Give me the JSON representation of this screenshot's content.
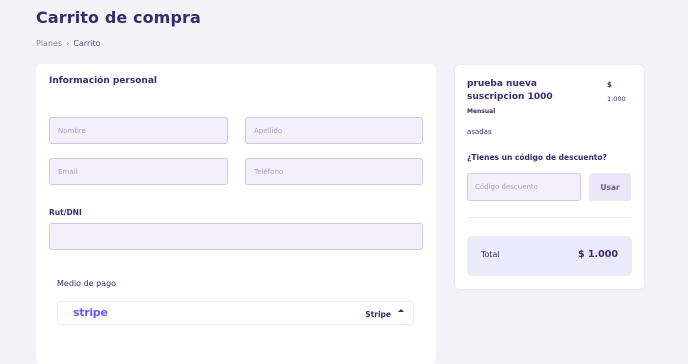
{
  "page": {
    "title": "Carrito de compra"
  },
  "breadcrumb": {
    "items": [
      "Planes",
      "Carrito"
    ],
    "separator": "›"
  },
  "personal_info": {
    "title": "Información personal",
    "fields": {
      "nombre": {
        "placeholder": "Nombre",
        "value": ""
      },
      "apellido": {
        "placeholder": "Apellido",
        "value": ""
      },
      "email": {
        "placeholder": "Email",
        "value": ""
      },
      "telefono": {
        "placeholder": "Teléfono",
        "value": ""
      },
      "rut": {
        "label": "Rut/DNI",
        "value": ""
      }
    }
  },
  "payment": {
    "label": "Medio de pago",
    "logo_text": "stripe",
    "selected_method": "Stripe",
    "caret_icon": "chevron-up-icon"
  },
  "summary": {
    "plan_name": "prueba nueva suscripcion 1000",
    "period": "Mensual",
    "currency": "$",
    "amount": "1.000",
    "description": "asadas",
    "discount_question": "¿Tienes un código de descuento?",
    "discount_placeholder": "Código descuento",
    "use_button": "Usar",
    "total_label": "Total",
    "total_value": "$ 1.000"
  },
  "colors": {
    "background": "#f4f3f8",
    "primary_text": "#3b2a6a",
    "input_bg": "#f3f0fb",
    "input_border": "#cfc6e6",
    "stripe": "#635bff",
    "total_bg": "#ebeafb"
  }
}
